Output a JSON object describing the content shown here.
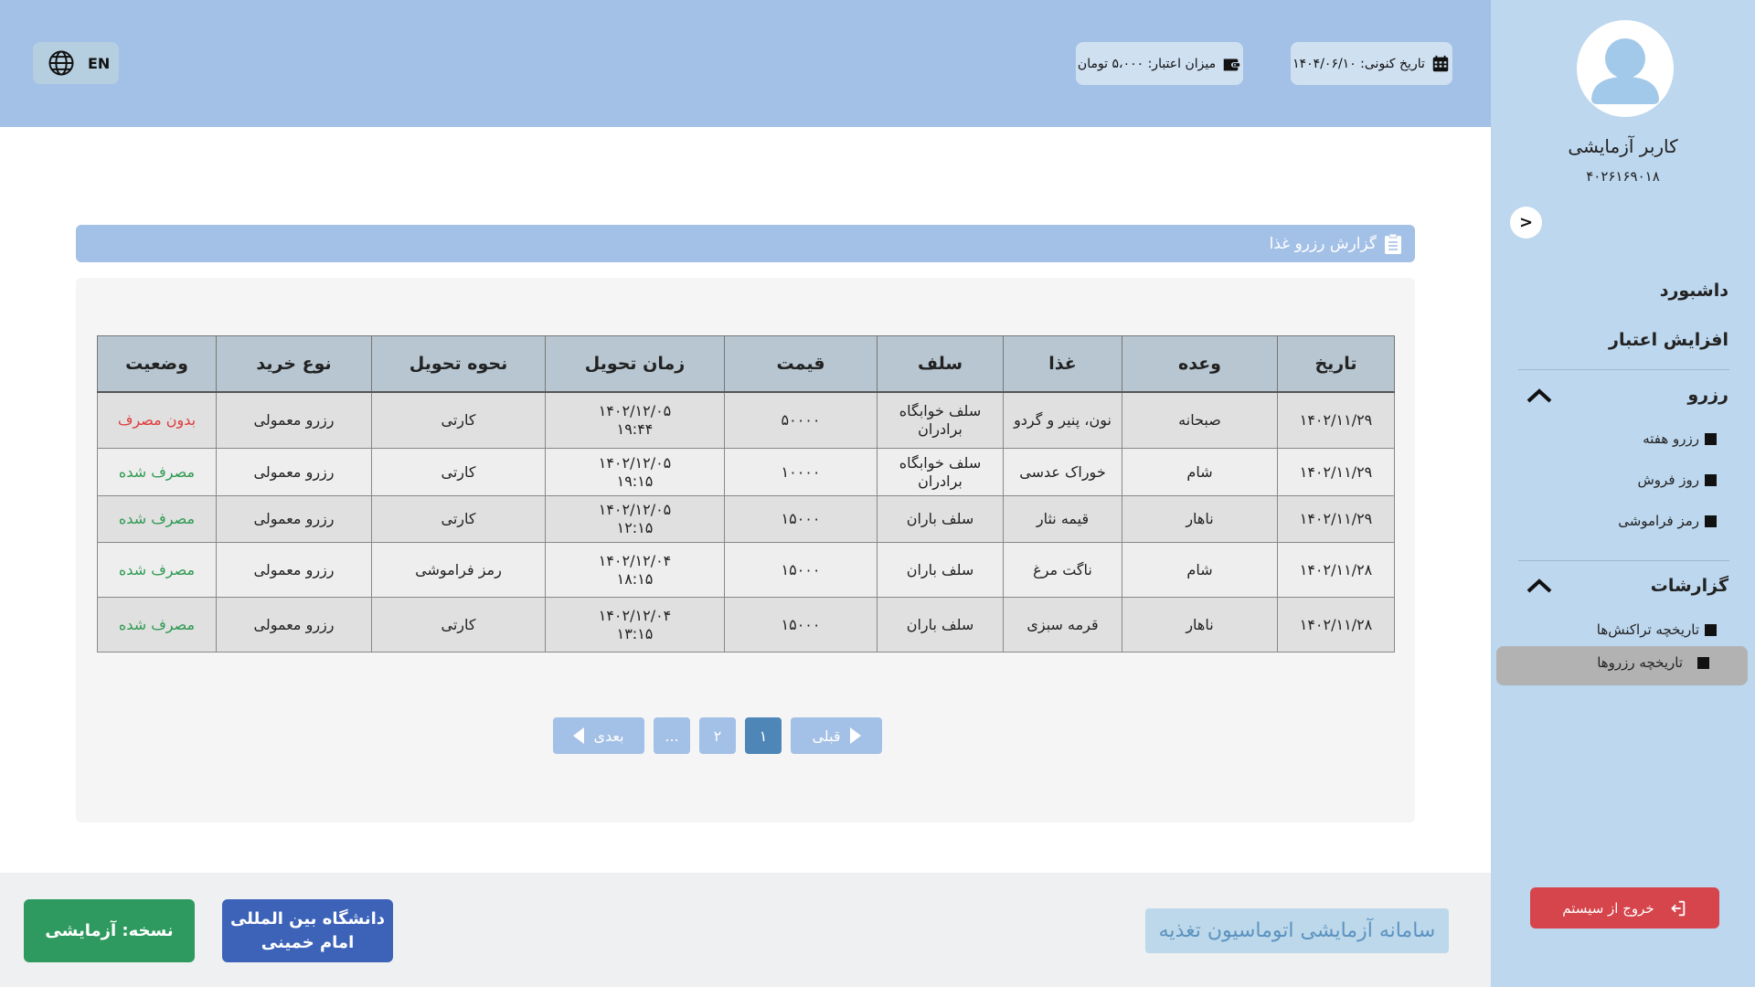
{
  "header": {
    "lang_label": "EN",
    "current_date": "تاریخ کنونی: ۱۴۰۴/۰۶/۱۰",
    "credit": "میزان اعتبار: ۵،۰۰۰ تومان"
  },
  "sidebar": {
    "user_name": "کاربر آزمایشی",
    "user_id": "۴۰۲۶۱۶۹۰۱۸",
    "collapse_label": ">",
    "dashboard": "داشبورد",
    "add_credit": "افزایش اعتبار",
    "reserve_group": "رزرو",
    "reserve_items": [
      "رزرو هفته",
      "روز فروش",
      "رمز فراموشی"
    ],
    "reports_group": "گزارشات",
    "reports_items": [
      "تاریخچه تراکنش‌ها",
      "تاریخچه رزروها"
    ],
    "logout": "خروج از سیستم"
  },
  "main": {
    "title": "گزارش رزرو غذا",
    "columns": [
      "تاریخ",
      "وعده",
      "غذا",
      "سلف",
      "قیمت",
      "زمان تحویل",
      "نحوه تحویل",
      "نوع خرید",
      "وضعیت"
    ],
    "rows": [
      {
        "date": "۱۴۰۲/۱۱/۲۹",
        "meal": "صبحانه",
        "food": "نون، پنیر و گردو",
        "cafeteria": "سلف خوابگاه برادران",
        "price": "۵۰۰۰۰",
        "time_date": "۱۴۰۲/۱۲/۰۵",
        "time_clock": "۱۹:۴۴",
        "delivery": "کارتی",
        "purchase": "رزرو معمولی",
        "status": "بدون مصرف",
        "status_kind": "red"
      },
      {
        "date": "۱۴۰۲/۱۱/۲۹",
        "meal": "شام",
        "food": "خوراک عدسی",
        "cafeteria": "سلف خوابگاه برادران",
        "price": "۱۰۰۰۰",
        "time_date": "۱۴۰۲/۱۲/۰۵",
        "time_clock": "۱۹:۱۵",
        "delivery": "کارتی",
        "purchase": "رزرو معمولی",
        "status": "مصرف شده",
        "status_kind": "green"
      },
      {
        "date": "۱۴۰۲/۱۱/۲۹",
        "meal": "ناهار",
        "food": "قیمه نثار",
        "cafeteria": "سلف باران",
        "price": "۱۵۰۰۰",
        "time_date": "۱۴۰۲/۱۲/۰۵",
        "time_clock": "۱۲:۱۵",
        "delivery": "کارتی",
        "purchase": "رزرو معمولی",
        "status": "مصرف شده",
        "status_kind": "green"
      },
      {
        "date": "۱۴۰۲/۱۱/۲۸",
        "meal": "شام",
        "food": "ناگت مرغ",
        "cafeteria": "سلف باران",
        "price": "۱۵۰۰۰",
        "time_date": "۱۴۰۲/۱۲/۰۴",
        "time_clock": "۱۸:۱۵",
        "delivery": "رمز فراموشی",
        "purchase": "رزرو معمولی",
        "status": "مصرف شده",
        "status_kind": "green"
      },
      {
        "date": "۱۴۰۲/۱۱/۲۸",
        "meal": "ناهار",
        "food": "قرمه سبزی",
        "cafeteria": "سلف باران",
        "price": "۱۵۰۰۰",
        "time_date": "۱۴۰۲/۱۲/۰۴",
        "time_clock": "۱۳:۱۵",
        "delivery": "کارتی",
        "purchase": "رزرو معمولی",
        "status": "مصرف شده",
        "status_kind": "green"
      }
    ],
    "pagination": {
      "next": "بعدی",
      "dots": "...",
      "page2": "۲",
      "page1": "۱",
      "prev": "قبلی"
    }
  },
  "footer": {
    "version": "نسخه: آزمایشی",
    "university_line1": "دانشگاه بین المللی",
    "university_line2": "امام خمینی",
    "system_name": "سامانه آزمایشی اتوماسیون تغذیه"
  },
  "colors": {
    "header_bg": "#a3c0e6",
    "sidebar_bg": "#bdd7ee",
    "status_red": "#e03c3c",
    "status_green": "#2e9a52",
    "logout_bg": "#d5454b"
  },
  "icons": [
    "globe-icon",
    "calendar-icon",
    "wallet-icon",
    "user-avatar-icon",
    "chevron-up-icon",
    "clipboard-icon",
    "logout-icon"
  ]
}
